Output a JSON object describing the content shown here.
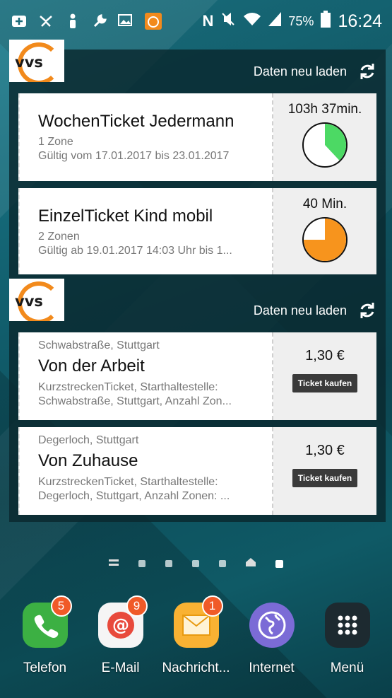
{
  "status_bar": {
    "battery_pct": "75%",
    "time": "16:24",
    "icons": [
      "add-box-icon",
      "fitness-icon",
      "person-icon",
      "wrench-icon",
      "image-message-icon",
      "vvs-icon",
      "nfc-icon",
      "mute-icon",
      "wifi-icon",
      "signal-icon",
      "battery-icon"
    ]
  },
  "widget1": {
    "logo_text": "vvs",
    "reload_label": "Daten neu laden",
    "tickets": [
      {
        "title": "WochenTicket Jedermann",
        "zones": "1 Zone",
        "validity": "Gültig vom 17.01.2017 bis 23.01.2017",
        "remaining": "103h 37min.",
        "remaining_fraction": 0.38,
        "dial_color": "#4cd964"
      },
      {
        "title": "EinzelTicket Kind mobil",
        "zones": "2 Zonen",
        "validity": "Gültig ab 19.01.2017 14:03 Uhr bis 1...",
        "remaining": "40 Min.",
        "remaining_fraction": 0.75,
        "dial_color": "#f7941d"
      }
    ]
  },
  "widget2": {
    "logo_text": "vvs",
    "reload_label": "Daten neu laden",
    "favorites": [
      {
        "location": "Schwabstraße, Stuttgart",
        "title": "Von der Arbeit",
        "desc_line1": "KurzstreckenTicket, Starthaltestelle:",
        "desc_line2": "Schwabstraße, Stuttgart, Anzahl Zon...",
        "price": "1,30 €",
        "buy_label": "Ticket kaufen"
      },
      {
        "location": "Degerloch, Stuttgart",
        "title": "Von Zuhause",
        "desc_line1": "KurzstreckenTicket, Starthaltestelle:",
        "desc_line2": "Degerloch, Stuttgart, Anzahl Zonen: ...",
        "price": "1,30 €",
        "buy_label": "Ticket kaufen"
      }
    ]
  },
  "pager": {
    "pages": 7,
    "active_index": 6
  },
  "dock": [
    {
      "label": "Telefon",
      "badge": "5",
      "icon": "phone-icon",
      "color": "#3cb043"
    },
    {
      "label": "E-Mail",
      "badge": "9",
      "icon": "email-icon",
      "color": "#e84a3c"
    },
    {
      "label": "Nachricht...",
      "badge": "1",
      "icon": "message-icon",
      "color": "#f9b233"
    },
    {
      "label": "Internet",
      "badge": "",
      "icon": "globe-icon",
      "color": "#7b6bd6"
    },
    {
      "label": "Menü",
      "badge": "",
      "icon": "apps-grid-icon",
      "color": "#1d2a30"
    }
  ]
}
